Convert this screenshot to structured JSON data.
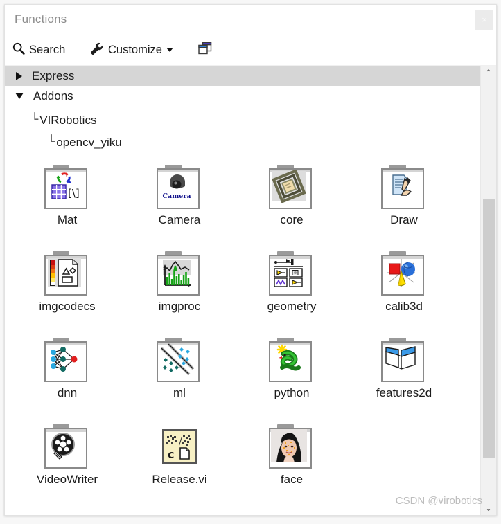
{
  "window": {
    "title": "Functions",
    "close_label": "×"
  },
  "toolbar": {
    "search_label": "Search",
    "search_icon": "magnifier-icon",
    "customize_label": "Customize",
    "customize_icon": "wrench-icon",
    "customize_caret": "chevron-down-icon",
    "pin_icon": "restore-window-icon"
  },
  "tree": {
    "rows": [
      {
        "label": "Express",
        "expanded": false,
        "selected": true
      },
      {
        "label": "Addons",
        "expanded": true,
        "selected": false
      }
    ],
    "children": [
      {
        "label": "VIRobotics",
        "elbow": "└",
        "indent": 38
      },
      {
        "label": "opencv_yiku",
        "elbow": "└",
        "indent": 62
      }
    ]
  },
  "grid": {
    "rows": [
      [
        {
          "caption": "Mat",
          "icon": "mat-folder-icon",
          "type": "folder"
        },
        {
          "caption": "Camera",
          "icon": "camera-folder-icon",
          "type": "folder"
        },
        {
          "caption": "core",
          "icon": "core-folder-icon",
          "type": "folder"
        },
        {
          "caption": "Draw",
          "icon": "draw-folder-icon",
          "type": "folder"
        }
      ],
      [
        {
          "caption": "imgcodecs",
          "icon": "imgcodecs-folder-icon",
          "type": "folder"
        },
        {
          "caption": "imgproc",
          "icon": "imgproc-folder-icon",
          "type": "folder"
        },
        {
          "caption": "geometry",
          "icon": "geometry-folder-icon",
          "type": "folder"
        },
        {
          "caption": "calib3d",
          "icon": "calib3d-folder-icon",
          "type": "folder"
        }
      ],
      [
        {
          "caption": "dnn",
          "icon": "dnn-folder-icon",
          "type": "folder"
        },
        {
          "caption": "ml",
          "icon": "ml-folder-icon",
          "type": "folder"
        },
        {
          "caption": "python",
          "icon": "python-folder-icon",
          "type": "folder"
        },
        {
          "caption": "features2d",
          "icon": "features2d-folder-icon",
          "type": "folder"
        }
      ],
      [
        {
          "caption": "VideoWriter",
          "icon": "videowriter-folder-icon",
          "type": "folder"
        },
        {
          "caption": "Release.vi",
          "icon": "release-vi-icon",
          "type": "vi"
        },
        {
          "caption": "face",
          "icon": "face-folder-icon",
          "type": "folder"
        }
      ]
    ]
  },
  "scrollbar": {
    "up_arrow": "⌃",
    "down_arrow": "⌄"
  },
  "watermark": {
    "text": "CSDN @virobotics"
  },
  "colors": {
    "selection": "#d6d6d6",
    "folder_border": "#8a8a8a",
    "scrollbar_thumb": "#cdcdcd",
    "vi_background": "#f7f0c4",
    "text": "#1c1c1c",
    "title_text": "#8c8c8c",
    "watermark": "#bdbdbd"
  }
}
